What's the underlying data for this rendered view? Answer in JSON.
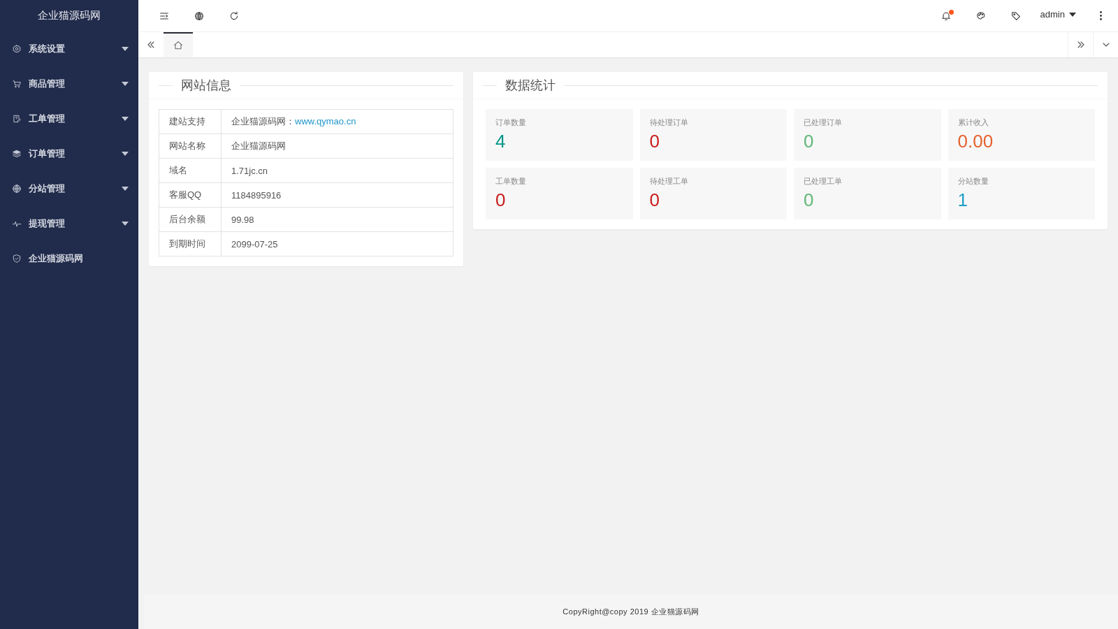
{
  "sidebar": {
    "logo": "企业猫源码网",
    "items": [
      {
        "label": "系统设置",
        "has_children": true
      },
      {
        "label": "商品管理",
        "has_children": true
      },
      {
        "label": "工单管理",
        "has_children": true
      },
      {
        "label": "订单管理",
        "has_children": true
      },
      {
        "label": "分站管理",
        "has_children": true
      },
      {
        "label": "提现管理",
        "has_children": true
      },
      {
        "label": "企业猫源码网",
        "has_children": false
      }
    ]
  },
  "header": {
    "notification_unread": true,
    "user": "admin"
  },
  "tabs": [
    {
      "selected": true
    }
  ],
  "site_info": {
    "title": "网站信息",
    "rows": [
      {
        "label": "建站支持",
        "value": "企业猫源码网：",
        "link": "www.qymao.cn"
      },
      {
        "label": "网站名称",
        "value": "企业猫源码网"
      },
      {
        "label": "域名",
        "value": "1.71jc.cn"
      },
      {
        "label": "客服QQ",
        "value": "1184895916"
      },
      {
        "label": "后台余额",
        "value": "99.98"
      },
      {
        "label": "到期时间",
        "value": "2099-07-25"
      }
    ]
  },
  "stats": {
    "title": "数据统计",
    "items": [
      {
        "label": "订单数量",
        "value": "4",
        "color": "#009688"
      },
      {
        "label": "待处理订单",
        "value": "0",
        "color": "#c91c1c"
      },
      {
        "label": "已处理订单",
        "value": "0",
        "color": "#5fb878"
      },
      {
        "label": "累计收入",
        "value": "0.00",
        "color": "#e5622f"
      },
      {
        "label": "工单数量",
        "value": "0",
        "color": "#c91c1c"
      },
      {
        "label": "待处理工单",
        "value": "0",
        "color": "#c91c1c"
      },
      {
        "label": "已处理工单",
        "value": "0",
        "color": "#5fb878"
      },
      {
        "label": "分站数量",
        "value": "1",
        "color": "#1e9fc5"
      }
    ]
  },
  "footer": "CopyRight@copy 2019 企业猫源码网"
}
